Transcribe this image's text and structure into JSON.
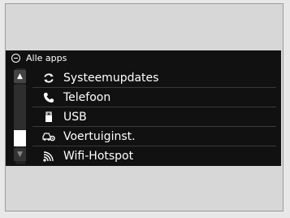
{
  "header": {
    "title": "Alle apps",
    "menu_icon": "app-list-icon"
  },
  "scrollbar": {
    "up_icon": "scroll-up-icon",
    "down_icon": "scroll-down-icon"
  },
  "list": {
    "items": [
      {
        "label": "Systeemupdates",
        "icon": "refresh-icon"
      },
      {
        "label": "Telefoon",
        "icon": "phone-icon"
      },
      {
        "label": "USB",
        "icon": "usb-icon"
      },
      {
        "label": "Voertuiginst.",
        "icon": "vehicle-settings-icon"
      },
      {
        "label": "Wifi-Hotspot",
        "icon": "wifi-hotspot-icon"
      }
    ]
  }
}
